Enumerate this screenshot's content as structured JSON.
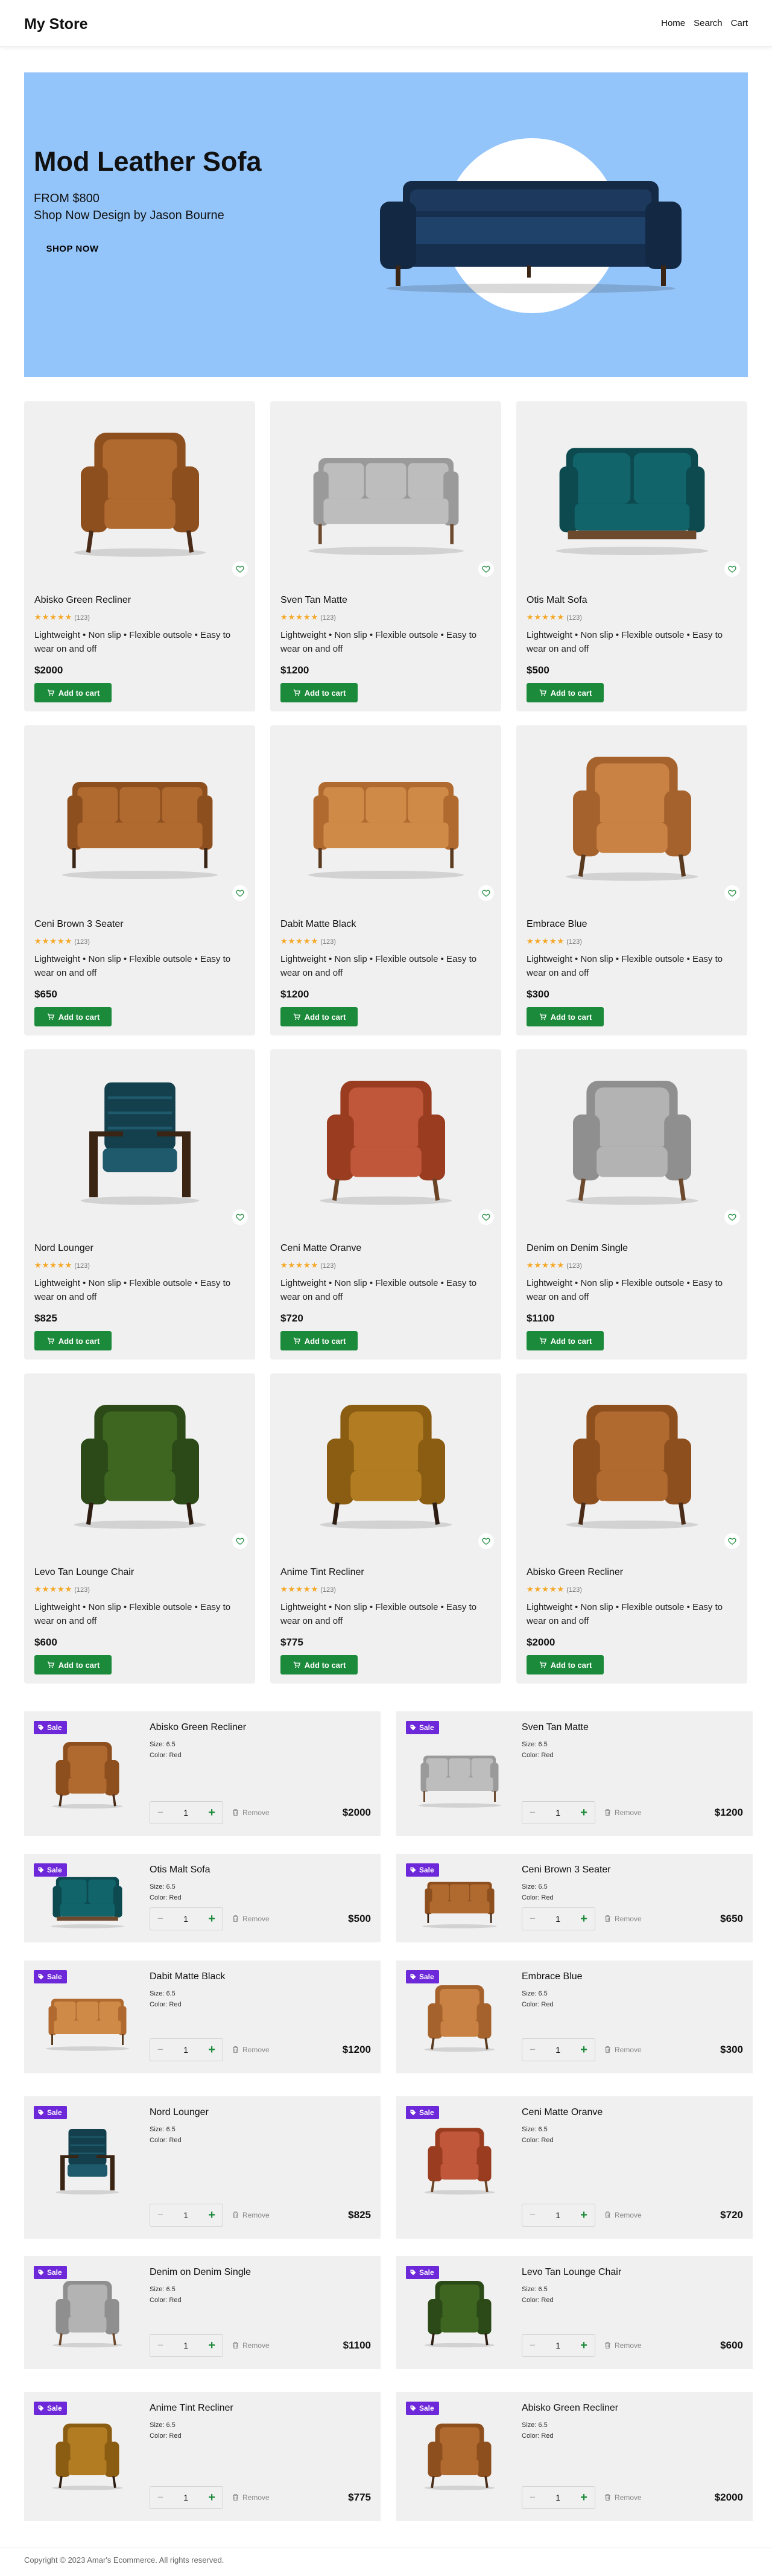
{
  "header": {
    "brand": "My Store",
    "nav": [
      "Home",
      "Search",
      "Cart"
    ]
  },
  "hero": {
    "title": "Mod Leather Sofa",
    "price": "FROM $800",
    "subtitle": "Shop Now Design by Jason Bourne",
    "cta": "SHOP NOW",
    "bg": "#94c5fa"
  },
  "products": [
    {
      "name": "Abisko Green Recliner",
      "rating": "★★★★★",
      "reviews": "(123)",
      "desc": "Lightweight • Non slip • Flexible outsole • Easy to wear on and off",
      "price": "$2000",
      "btn": "Add to cart",
      "icon": "armchair-cognac"
    },
    {
      "name": "Sven Tan Matte",
      "rating": "★★★★★",
      "reviews": "(123)",
      "desc": "Lightweight • Non slip • Flexible outsole • Easy to wear on and off",
      "price": "$1200",
      "btn": "Add to cart",
      "icon": "sofa-gray"
    },
    {
      "name": "Otis Malt Sofa",
      "rating": "★★★★★",
      "reviews": "(123)",
      "desc": "Lightweight • Non slip • Flexible outsole • Easy to wear on and off",
      "price": "$500",
      "btn": "Add to cart",
      "icon": "loveseat-teal"
    },
    {
      "name": "Ceni Brown 3 Seater",
      "rating": "★★★★★",
      "reviews": "(123)",
      "desc": "Lightweight • Non slip • Flexible outsole • Easy to wear on and off",
      "price": "$650",
      "btn": "Add to cart",
      "icon": "sofa-brown"
    },
    {
      "name": "Dabit Matte Black",
      "rating": "★★★★★",
      "reviews": "(123)",
      "desc": "Lightweight • Non slip • Flexible outsole • Easy to wear on and off",
      "price": "$1200",
      "btn": "Add to cart",
      "icon": "sofa-tan"
    },
    {
      "name": "Embrace Blue",
      "rating": "★★★★★",
      "reviews": "(123)",
      "desc": "Lightweight • Non slip • Flexible outsole • Easy to wear on and off",
      "price": "$300",
      "btn": "Add to cart",
      "icon": "armchair-tan"
    },
    {
      "name": "Nord Lounger",
      "rating": "★★★★★",
      "reviews": "(123)",
      "desc": "Lightweight • Non slip • Flexible outsole • Easy to wear on and off",
      "price": "$825",
      "btn": "Add to cart",
      "icon": "lounger-teal"
    },
    {
      "name": "Ceni Matte Oranve",
      "rating": "★★★★★",
      "reviews": "(123)",
      "desc": "Lightweight • Non slip • Flexible outsole • Easy to wear on and off",
      "price": "$720",
      "btn": "Add to cart",
      "icon": "armchair-rust"
    },
    {
      "name": "Denim on Denim Single",
      "rating": "★★★★★",
      "reviews": "(123)",
      "desc": "Lightweight • Non slip • Flexible outsole • Easy to wear on and off",
      "price": "$1100",
      "btn": "Add to cart",
      "icon": "armchair-gray"
    },
    {
      "name": "Levo Tan Lounge Chair",
      "rating": "★★★★★",
      "reviews": "(123)",
      "desc": "Lightweight • Non slip • Flexible outsole • Easy to wear on and off",
      "price": "$600",
      "btn": "Add to cart",
      "icon": "armchair-green"
    },
    {
      "name": "Anime Tint Recliner",
      "rating": "★★★★★",
      "reviews": "(123)",
      "desc": "Lightweight • Non slip • Flexible outsole • Easy to wear on and off",
      "price": "$775",
      "btn": "Add to cart",
      "icon": "armchair-mustard"
    },
    {
      "name": "Abisko Green Recliner",
      "rating": "★★★★★",
      "reviews": "(123)",
      "desc": "Lightweight • Non slip • Flexible outsole • Easy to wear on and off",
      "price": "$2000",
      "btn": "Add to cart",
      "icon": "armchair-cognac"
    }
  ],
  "cart": {
    "sale_label": "Sale",
    "size_label": "Size: 6.5",
    "color_label": "Color: Red",
    "qty": "1",
    "remove_label": "Remove",
    "items": [
      {
        "name": "Abisko Green Recliner",
        "price": "$2000",
        "icon": "armchair-cognac"
      },
      {
        "name": "Sven Tan Matte",
        "price": "$1200",
        "icon": "sofa-gray"
      },
      {
        "name": "Otis Malt Sofa",
        "price": "$500",
        "icon": "loveseat-teal"
      },
      {
        "name": "Ceni Brown 3 Seater",
        "price": "$650",
        "icon": "sofa-brown"
      },
      {
        "name": "Dabit Matte Black",
        "price": "$1200",
        "icon": "sofa-tan"
      },
      {
        "name": "Embrace Blue",
        "price": "$300",
        "icon": "armchair-tan"
      },
      {
        "name": "Nord Lounger",
        "price": "$825",
        "icon": "lounger-teal"
      },
      {
        "name": "Ceni Matte Oranve",
        "price": "$720",
        "icon": "armchair-rust"
      },
      {
        "name": "Denim on Denim Single",
        "price": "$1100",
        "icon": "armchair-gray"
      },
      {
        "name": "Levo Tan Lounge Chair",
        "price": "$600",
        "icon": "armchair-green"
      },
      {
        "name": "Anime Tint Recliner",
        "price": "$775",
        "icon": "armchair-mustard"
      },
      {
        "name": "Abisko Green Recliner",
        "price": "$2000",
        "icon": "armchair-cognac"
      }
    ]
  },
  "footer": {
    "text": "Copyright © 2023 Amar's Ecommerce. All rights reserved."
  },
  "colors": {
    "accent_green": "#1b8a3a",
    "sale_purple": "#6d28d9",
    "card_bg": "#f0f0f0",
    "star": "#f5a623"
  }
}
